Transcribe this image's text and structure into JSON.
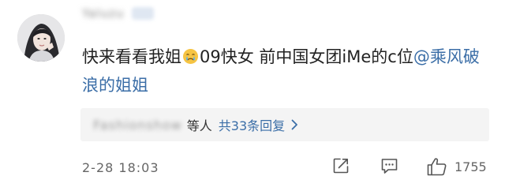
{
  "comment": {
    "username": "Yaluzu",
    "text_part1": "快来看看我姐",
    "emoji": "crying-face-icon",
    "text_part2": "09快女 前中国女团iMe的c位",
    "mention": "@乘风破浪的姐姐"
  },
  "replies": {
    "user": "Fashionshow",
    "connector": "等人",
    "count_label": "共33条回复"
  },
  "footer": {
    "timestamp": "2-28 18:03",
    "like_count": "1755"
  },
  "colors": {
    "link": "#3b6ea7",
    "text": "#222222",
    "muted": "#666666",
    "reply_bg": "#f4f4f4"
  },
  "icons": [
    "share-icon",
    "comment-icon",
    "like-icon",
    "chevron-right-icon"
  ]
}
